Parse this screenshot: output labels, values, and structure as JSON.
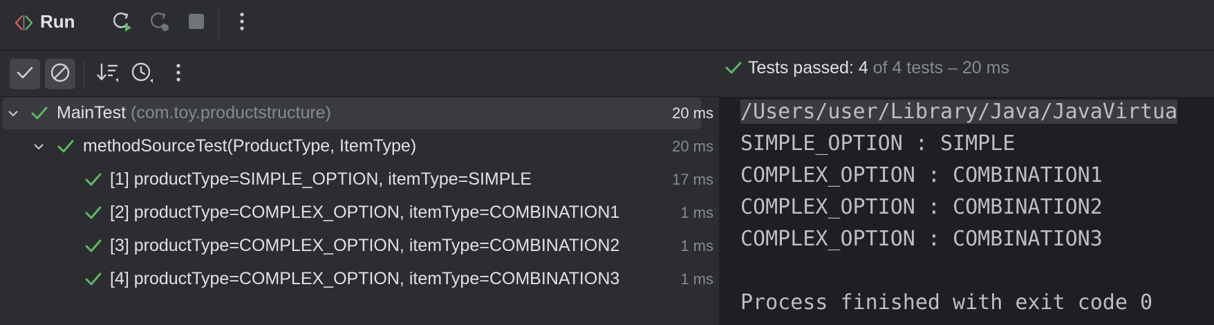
{
  "header": {
    "title": "Run",
    "buttons": [
      {
        "name": "rerun-button",
        "icon": "rerun-icon"
      },
      {
        "name": "rerun-failed-button",
        "icon": "rerun-failed-icon"
      },
      {
        "name": "stop-button",
        "icon": "stop-icon"
      },
      {
        "name": "more-options-button",
        "icon": "more-vertical-icon"
      }
    ]
  },
  "test_toolbar": {
    "show_passed": true,
    "show_ignored": true
  },
  "status": {
    "prefix": "Tests passed: ",
    "passed": "4",
    "suffix": " of 4 tests – 20 ms"
  },
  "tree": {
    "root": {
      "name": "MainTest",
      "package": " (com.toy.productstructure)",
      "duration": "20 ms"
    },
    "method": {
      "name": "methodSourceTest(ProductType, ItemType)",
      "duration": "20 ms"
    },
    "cases": [
      {
        "label": "[1] productType=SIMPLE_OPTION, itemType=SIMPLE",
        "duration": "17 ms"
      },
      {
        "label": "[2] productType=COMPLEX_OPTION, itemType=COMBINATION1",
        "duration": "1 ms"
      },
      {
        "label": "[3] productType=COMPLEX_OPTION, itemType=COMBINATION2",
        "duration": "1 ms"
      },
      {
        "label": "[4] productType=COMPLEX_OPTION, itemType=COMBINATION3",
        "duration": "1 ms"
      }
    ]
  },
  "console": {
    "lines": [
      "/Users/user/Library/Java/JavaVirtua",
      "SIMPLE_OPTION : SIMPLE",
      "COMPLEX_OPTION : COMBINATION1",
      "COMPLEX_OPTION : COMBINATION2",
      "COMPLEX_OPTION : COMBINATION3",
      "",
      "Process finished with exit code 0"
    ]
  },
  "colors": {
    "success": "#5fb865",
    "background": "#2b2d30",
    "console_background": "#1e1f22"
  }
}
